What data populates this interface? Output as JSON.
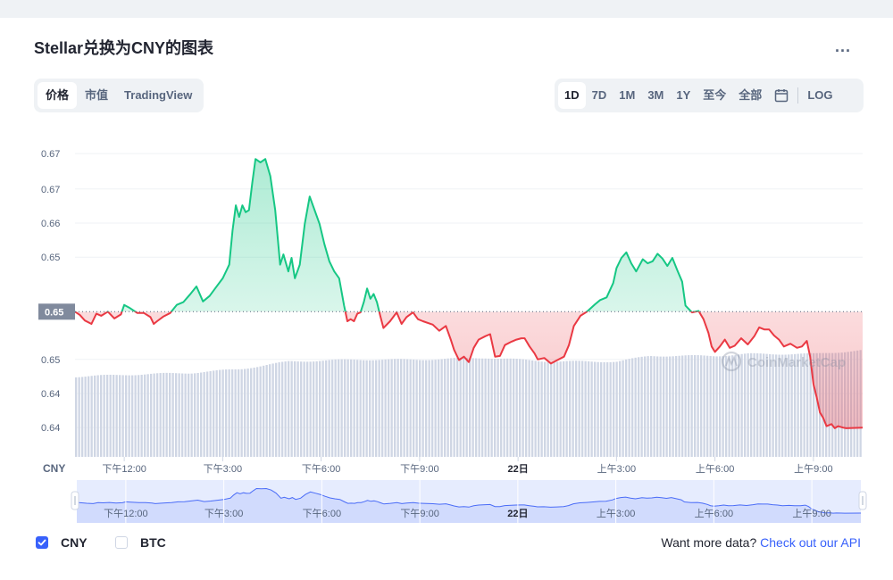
{
  "title": "Stellar兑换为CNY的图表",
  "more_label": "...",
  "tabs_left": [
    {
      "label": "价格",
      "active": true
    },
    {
      "label": "市值",
      "active": false
    },
    {
      "label": "TradingView",
      "active": false
    }
  ],
  "tabs_right": [
    {
      "label": "1D",
      "active": true
    },
    {
      "label": "7D",
      "active": false
    },
    {
      "label": "1M",
      "active": false
    },
    {
      "label": "3M",
      "active": false
    },
    {
      "label": "1Y",
      "active": false
    },
    {
      "label": "至今",
      "active": false
    },
    {
      "label": "全部",
      "active": false
    }
  ],
  "log_label": "LOG",
  "calendar_icon": "calendar-icon",
  "legend": [
    {
      "label": "CNY",
      "checked": true
    },
    {
      "label": "BTC",
      "checked": false
    }
  ],
  "more_data": {
    "text": "Want more data?",
    "link": "Check out our API"
  },
  "watermark": "CoinMarketCap",
  "colors": {
    "up": "#16c784",
    "down": "#ea3943",
    "accent": "#3861fb",
    "text_muted": "#58667e",
    "volume": "#cfd6e4"
  },
  "chart_data": {
    "type": "line",
    "currency_label": "CNY",
    "baseline": 0.6511,
    "baseline_label": "0.65",
    "y_ticks": [
      {
        "value": 0.6743,
        "label": "0.67"
      },
      {
        "value": 0.6691,
        "label": "0.67"
      },
      {
        "value": 0.6641,
        "label": "0.66"
      },
      {
        "value": 0.6591,
        "label": "0.65"
      },
      {
        "value": 0.6441,
        "label": "0.65"
      },
      {
        "value": 0.6391,
        "label": "0.64"
      },
      {
        "value": 0.6341,
        "label": "0.64"
      }
    ],
    "x_ticks": [
      {
        "t": 1.0,
        "label": "下午12:00",
        "bold": false
      },
      {
        "t": 4.0,
        "label": "下午3:00",
        "bold": false
      },
      {
        "t": 7.0,
        "label": "下午6:00",
        "bold": false
      },
      {
        "t": 10.0,
        "label": "下午9:00",
        "bold": false
      },
      {
        "t": 13.0,
        "label": "22日",
        "bold": true
      },
      {
        "t": 16.0,
        "label": "上午3:00",
        "bold": false
      },
      {
        "t": 19.0,
        "label": "上午6:00",
        "bold": false
      },
      {
        "t": 22.0,
        "label": "上午9:00",
        "bold": false
      }
    ],
    "x_range": [
      -0.5,
      23.5
    ],
    "ylim": [
      0.6298,
      0.6785
    ],
    "price": [
      [
        -0.5,
        0.6511
      ],
      [
        -0.35,
        0.6506
      ],
      [
        -0.2,
        0.6498
      ],
      [
        0.0,
        0.6493
      ],
      [
        0.15,
        0.6508
      ],
      [
        0.3,
        0.6505
      ],
      [
        0.5,
        0.6511
      ],
      [
        0.7,
        0.6501
      ],
      [
        0.9,
        0.6507
      ],
      [
        1.0,
        0.6521
      ],
      [
        1.15,
        0.6517
      ],
      [
        1.4,
        0.6509
      ],
      [
        1.6,
        0.6509
      ],
      [
        1.8,
        0.6503
      ],
      [
        1.9,
        0.6493
      ],
      [
        2.0,
        0.6497
      ],
      [
        2.2,
        0.6504
      ],
      [
        2.4,
        0.6509
      ],
      [
        2.6,
        0.6521
      ],
      [
        2.8,
        0.6525
      ],
      [
        3.0,
        0.6536
      ],
      [
        3.2,
        0.6548
      ],
      [
        3.4,
        0.6526
      ],
      [
        3.6,
        0.6534
      ],
      [
        3.8,
        0.6547
      ],
      [
        4.0,
        0.656
      ],
      [
        4.2,
        0.658
      ],
      [
        4.3,
        0.663
      ],
      [
        4.4,
        0.6667
      ],
      [
        4.5,
        0.665
      ],
      [
        4.6,
        0.6667
      ],
      [
        4.7,
        0.6657
      ],
      [
        4.8,
        0.666
      ],
      [
        4.9,
        0.67
      ],
      [
        5.0,
        0.6735
      ],
      [
        5.15,
        0.673
      ],
      [
        5.3,
        0.6735
      ],
      [
        5.45,
        0.671
      ],
      [
        5.6,
        0.666
      ],
      [
        5.75,
        0.658
      ],
      [
        5.85,
        0.6595
      ],
      [
        6.0,
        0.657
      ],
      [
        6.1,
        0.659
      ],
      [
        6.2,
        0.656
      ],
      [
        6.35,
        0.658
      ],
      [
        6.5,
        0.664
      ],
      [
        6.65,
        0.668
      ],
      [
        6.8,
        0.666
      ],
      [
        6.95,
        0.664
      ],
      [
        7.1,
        0.661
      ],
      [
        7.25,
        0.6585
      ],
      [
        7.4,
        0.657
      ],
      [
        7.55,
        0.656
      ],
      [
        7.7,
        0.652
      ],
      [
        7.8,
        0.6497
      ],
      [
        7.9,
        0.65
      ],
      [
        8.0,
        0.6497
      ],
      [
        8.1,
        0.6508
      ],
      [
        8.2,
        0.651
      ],
      [
        8.3,
        0.6525
      ],
      [
        8.4,
        0.6545
      ],
      [
        8.5,
        0.653
      ],
      [
        8.6,
        0.6537
      ],
      [
        8.7,
        0.6525
      ],
      [
        8.8,
        0.6505
      ],
      [
        8.9,
        0.6487
      ],
      [
        9.1,
        0.6497
      ],
      [
        9.3,
        0.651
      ],
      [
        9.45,
        0.6493
      ],
      [
        9.6,
        0.6503
      ],
      [
        9.8,
        0.651
      ],
      [
        9.95,
        0.65
      ],
      [
        10.1,
        0.6497
      ],
      [
        10.4,
        0.6492
      ],
      [
        10.6,
        0.6483
      ],
      [
        10.8,
        0.649
      ],
      [
        10.95,
        0.647
      ],
      [
        11.05,
        0.6455
      ],
      [
        11.2,
        0.644
      ],
      [
        11.35,
        0.6445
      ],
      [
        11.5,
        0.6437
      ],
      [
        11.65,
        0.6458
      ],
      [
        11.8,
        0.647
      ],
      [
        12.0,
        0.6475
      ],
      [
        12.15,
        0.6478
      ],
      [
        12.3,
        0.6445
      ],
      [
        12.45,
        0.6446
      ],
      [
        12.6,
        0.6462
      ],
      [
        12.8,
        0.6467
      ],
      [
        12.95,
        0.647
      ],
      [
        13.1,
        0.6472
      ],
      [
        13.2,
        0.6472
      ],
      [
        13.35,
        0.646
      ],
      [
        13.5,
        0.645
      ],
      [
        13.6,
        0.6441
      ],
      [
        13.8,
        0.6443
      ],
      [
        14.0,
        0.6435
      ],
      [
        14.2,
        0.644
      ],
      [
        14.4,
        0.6445
      ],
      [
        14.55,
        0.6462
      ],
      [
        14.7,
        0.649
      ],
      [
        14.9,
        0.6505
      ],
      [
        15.1,
        0.6511
      ],
      [
        15.35,
        0.6522
      ],
      [
        15.5,
        0.6528
      ],
      [
        15.7,
        0.6532
      ],
      [
        15.9,
        0.6553
      ],
      [
        16.0,
        0.6575
      ],
      [
        16.15,
        0.659
      ],
      [
        16.3,
        0.6598
      ],
      [
        16.45,
        0.6582
      ],
      [
        16.6,
        0.657
      ],
      [
        16.8,
        0.6588
      ],
      [
        16.95,
        0.6582
      ],
      [
        17.1,
        0.6585
      ],
      [
        17.25,
        0.6596
      ],
      [
        17.4,
        0.6589
      ],
      [
        17.55,
        0.6578
      ],
      [
        17.7,
        0.659
      ],
      [
        17.85,
        0.6572
      ],
      [
        18.0,
        0.6555
      ],
      [
        18.1,
        0.652
      ],
      [
        18.3,
        0.651
      ],
      [
        18.5,
        0.6512
      ],
      [
        18.65,
        0.65
      ],
      [
        18.8,
        0.648
      ],
      [
        18.9,
        0.646
      ],
      [
        19.0,
        0.6452
      ],
      [
        19.15,
        0.646
      ],
      [
        19.3,
        0.647
      ],
      [
        19.45,
        0.6458
      ],
      [
        19.6,
        0.6461
      ],
      [
        19.8,
        0.6472
      ],
      [
        20.0,
        0.6463
      ],
      [
        20.2,
        0.6475
      ],
      [
        20.35,
        0.6488
      ],
      [
        20.5,
        0.6485
      ],
      [
        20.65,
        0.6485
      ],
      [
        20.8,
        0.6476
      ],
      [
        20.95,
        0.647
      ],
      [
        21.1,
        0.646
      ],
      [
        21.3,
        0.6464
      ],
      [
        21.5,
        0.6458
      ],
      [
        21.65,
        0.646
      ],
      [
        21.8,
        0.6468
      ],
      [
        21.9,
        0.6445
      ],
      [
        22.0,
        0.6405
      ],
      [
        22.1,
        0.6385
      ],
      [
        22.2,
        0.6363
      ],
      [
        22.3,
        0.6355
      ],
      [
        22.4,
        0.6343
      ],
      [
        22.55,
        0.6346
      ],
      [
        22.65,
        0.634
      ],
      [
        22.75,
        0.6343
      ],
      [
        22.9,
        0.6341
      ],
      [
        23.0,
        0.634
      ],
      [
        23.5,
        0.6341
      ]
    ],
    "volume_rel": [
      [
        -0.5,
        0.42
      ],
      [
        1.0,
        0.43
      ],
      [
        3.0,
        0.44
      ],
      [
        4.5,
        0.46
      ],
      [
        6.0,
        0.5
      ],
      [
        8.0,
        0.51
      ],
      [
        10.0,
        0.51
      ],
      [
        12.0,
        0.52
      ],
      [
        14.0,
        0.5
      ],
      [
        16.0,
        0.5
      ],
      [
        17.0,
        0.53
      ],
      [
        19.0,
        0.53
      ],
      [
        20.0,
        0.54
      ],
      [
        22.0,
        0.54
      ],
      [
        23.5,
        0.56
      ]
    ]
  }
}
